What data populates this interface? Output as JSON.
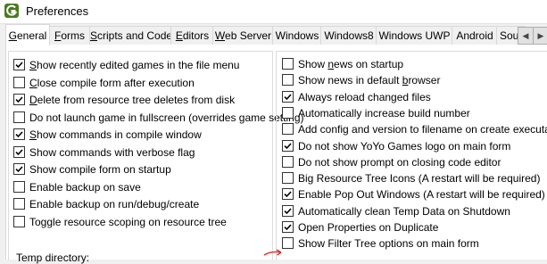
{
  "window": {
    "title": "Preferences",
    "icon": "gamemaker-logo-icon"
  },
  "tabs": [
    {
      "label": "General",
      "accel": "G",
      "active": true
    },
    {
      "label": "Forms",
      "accel": "F",
      "active": false
    },
    {
      "label": "Scripts and Code",
      "accel": "S",
      "active": false
    },
    {
      "label": "Editors",
      "accel": "E",
      "active": false
    },
    {
      "label": "Web Server",
      "accel": "W",
      "active": false
    },
    {
      "label": "Windows",
      "accel": "",
      "active": false
    },
    {
      "label": "Windows8",
      "accel": "",
      "active": false
    },
    {
      "label": "Windows UWP",
      "accel": "",
      "active": false
    },
    {
      "label": "Android",
      "accel": "",
      "active": false
    },
    {
      "label": "Sou",
      "accel": "",
      "active": false
    }
  ],
  "left_options": [
    {
      "pre": "",
      "accel": "S",
      "post": "how recently edited games in the file menu",
      "checked": true
    },
    {
      "pre": "",
      "accel": "C",
      "post": "lose compile form after execution",
      "checked": false
    },
    {
      "pre": "",
      "accel": "D",
      "post": "elete from resource tree deletes from disk",
      "checked": true
    },
    {
      "pre": "Do not launch game in fullscreen (overrides game setting)",
      "accel": "",
      "post": "",
      "checked": false
    },
    {
      "pre": "",
      "accel": "S",
      "post": "how commands in compile window",
      "checked": true
    },
    {
      "pre": "Show commands with verbose flag",
      "accel": "",
      "post": "",
      "checked": true
    },
    {
      "pre": "Show compile form on startup",
      "accel": "",
      "post": "",
      "checked": true
    },
    {
      "pre": "Enable backup on save",
      "accel": "",
      "post": "",
      "checked": false
    },
    {
      "pre": "Enable backup on run/debug/create",
      "accel": "",
      "post": "",
      "checked": false
    },
    {
      "pre": "Toggle resource scoping on resource tree",
      "accel": "",
      "post": "",
      "checked": false
    }
  ],
  "right_options": [
    {
      "pre": "Show ",
      "accel": "n",
      "post": "ews on startup",
      "checked": false
    },
    {
      "pre": "Show news in default ",
      "accel": "b",
      "post": "rowser",
      "checked": false
    },
    {
      "pre": "Always reload changed files",
      "accel": "",
      "post": "",
      "checked": true
    },
    {
      "pre": "Automatically increase build number",
      "accel": "",
      "post": "",
      "checked": false
    },
    {
      "pre": "Add config and version to filename on create executable",
      "accel": "",
      "post": "",
      "checked": false
    },
    {
      "pre": "Do not show YoYo Games logo on main form",
      "accel": "",
      "post": "",
      "checked": true
    },
    {
      "pre": "Do not show prompt on closing code editor",
      "accel": "",
      "post": "",
      "checked": false
    },
    {
      "pre": "Big Resource Tree Icons (A restart will be required)",
      "accel": "",
      "post": "",
      "checked": false
    },
    {
      "pre": "Enable Pop Out Windows (A restart will be required)",
      "accel": "",
      "post": "",
      "checked": true
    },
    {
      "pre": "Automatically clean Temp Data on Shutdown",
      "accel": "",
      "post": "",
      "checked": true
    },
    {
      "pre": "Open Properties on Duplicate",
      "accel": "",
      "post": "",
      "checked": true
    },
    {
      "pre": "Show Filter Tree options on main form",
      "accel": "",
      "post": "",
      "checked": false
    }
  ],
  "temp_directory_label": "Temp directory:",
  "annotation": {
    "icon": "red-arrow-icon",
    "color": "#d9302c"
  },
  "colors": {
    "panel": "#ffffff",
    "chrome": "#f0f0f0",
    "logo": "#4a7a1f"
  }
}
